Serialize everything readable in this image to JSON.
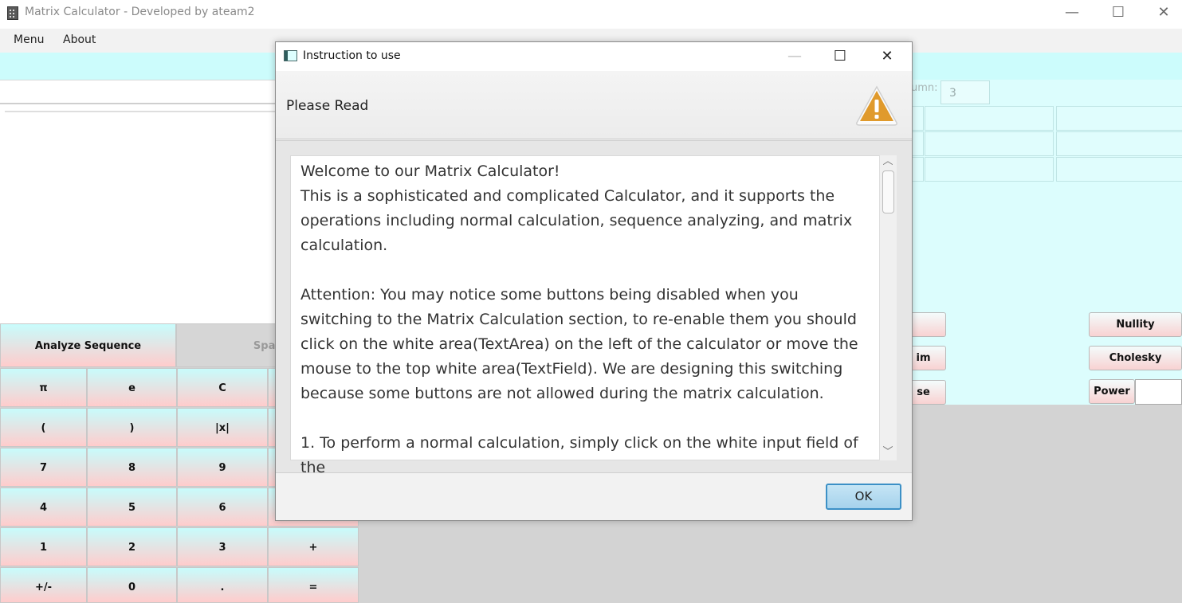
{
  "window": {
    "title": "Matrix Calculator - Developed by ateam2",
    "controls": {
      "minimize": "—",
      "maximize": "☐",
      "close": "✕"
    }
  },
  "menubar": {
    "items": [
      {
        "label": "Menu"
      },
      {
        "label": "About"
      }
    ]
  },
  "matrix_panel": {
    "column_label": "umn:",
    "column_value": "3"
  },
  "right_buttons": {
    "nullity": "Nullity",
    "cholesky": "Cholesky",
    "power": "Power",
    "partial_1": "",
    "partial_2": "im",
    "partial_3": "se"
  },
  "keypad": {
    "analyze_sequence": "Analyze Sequence",
    "space": "Spac",
    "rows": [
      [
        "π",
        "e",
        "C"
      ],
      [
        "(",
        ")",
        "|x|"
      ],
      [
        "7",
        "8",
        "9"
      ],
      [
        "4",
        "5",
        "6"
      ],
      [
        "1",
        "2",
        "3",
        "+"
      ],
      [
        "+/-",
        "0",
        ".",
        "="
      ]
    ]
  },
  "dialog": {
    "title": "Instruction to use",
    "controls": {
      "minimize": "—",
      "maximize": "☐",
      "close": "✕"
    },
    "header": "Please Read",
    "warning_icon": "warning-triangle-icon",
    "content": "Welcome to our Matrix Calculator!\nThis is a sophisticated and complicated Calculator, and it supports the operations including normal calculation, sequence analyzing, and matrix calculation.\n\nAttention: You may notice some buttons being disabled when you switching to the Matrix Calculation section, to re-enable them you should click on the white area(TextArea) on the left of the calculator or move the mouse to the top white area(TextField). We are designing this switching because some buttons are not allowed during the matrix calculation.\n\n1. To perform a normal calculation, simply click on the white input field of the",
    "scroll_up": "︿",
    "scroll_down": "﹀",
    "ok_label": "OK"
  },
  "colors": {
    "cyan_bg": "#ccfcfc",
    "button_gradient_top": "#c8fcfc",
    "button_gradient_bottom": "#ffcccc",
    "ok_border": "#3c90c6",
    "warning": "#e09a2c"
  }
}
